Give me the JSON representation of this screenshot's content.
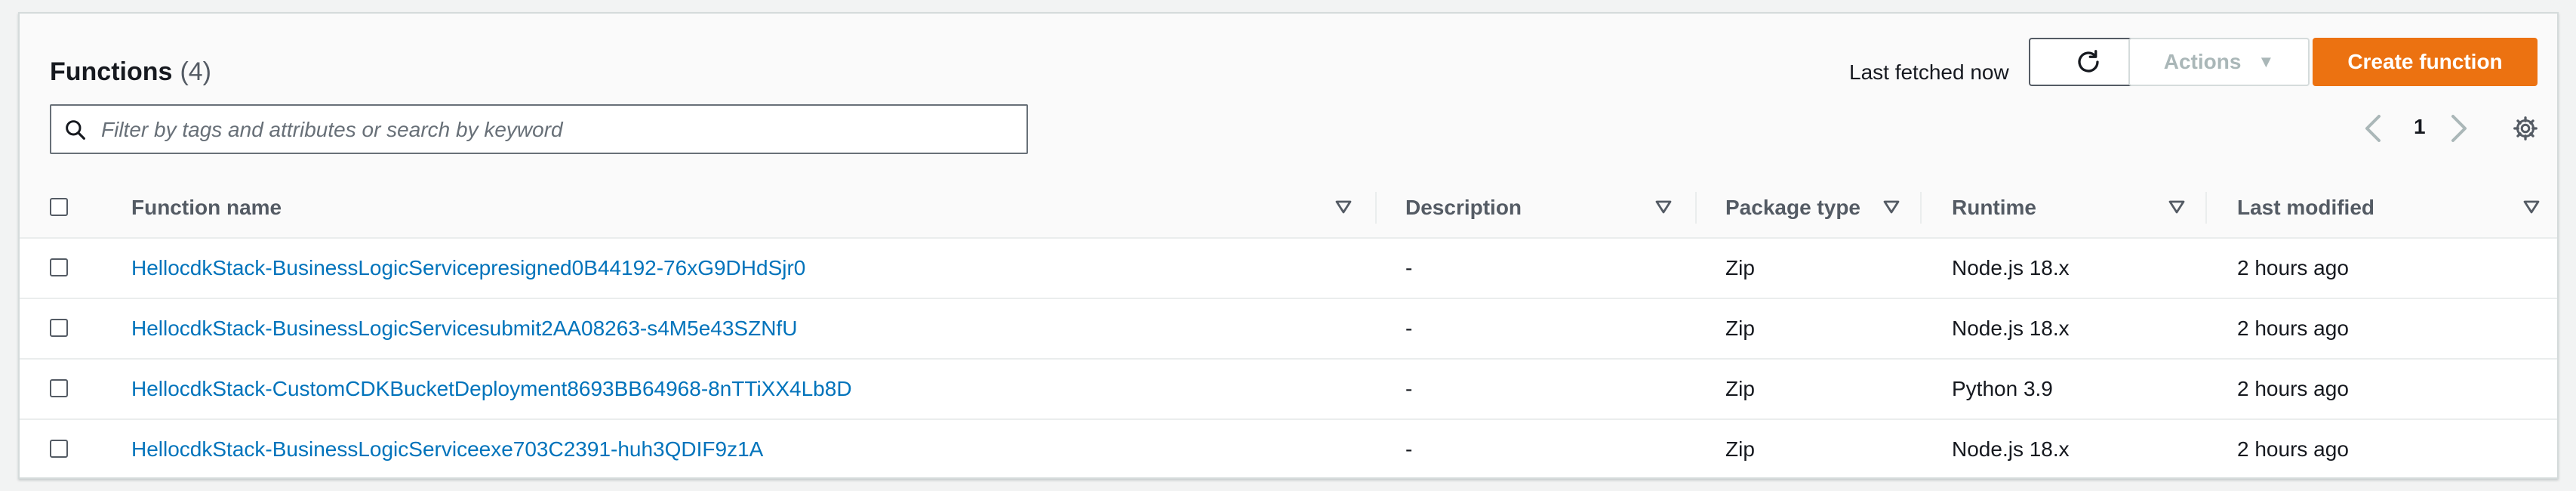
{
  "panel": {
    "title": "Functions",
    "count": "(4)",
    "last_fetched": "Last fetched now",
    "actions_label": "Actions",
    "create_label": "Create function",
    "search_placeholder": "Filter by tags and attributes or search by keyword",
    "page": "1"
  },
  "table": {
    "columns": [
      "Function name",
      "Description",
      "Package type",
      "Runtime",
      "Last modified"
    ],
    "rows": [
      {
        "name": "HellocdkStack-BusinessLogicServicepresigned0B44192-76xG9DHdSjr0",
        "description": "-",
        "package": "Zip",
        "runtime": "Node.js 18.x",
        "modified": "2 hours ago"
      },
      {
        "name": "HellocdkStack-BusinessLogicServicesubmit2AA08263-s4M5e43SZNfU",
        "description": "-",
        "package": "Zip",
        "runtime": "Node.js 18.x",
        "modified": "2 hours ago"
      },
      {
        "name": "HellocdkStack-CustomCDKBucketDeployment8693BB64968-8nTTiXX4Lb8D",
        "description": "-",
        "package": "Zip",
        "runtime": "Python 3.9",
        "modified": "2 hours ago"
      },
      {
        "name": "HellocdkStack-BusinessLogicServiceexe703C2391-huh3QDIF9z1A",
        "description": "-",
        "package": "Zip",
        "runtime": "Node.js 18.x",
        "modified": "2 hours ago"
      }
    ]
  },
  "colors": {
    "accent": "#ec7211",
    "link": "#0073bb"
  }
}
